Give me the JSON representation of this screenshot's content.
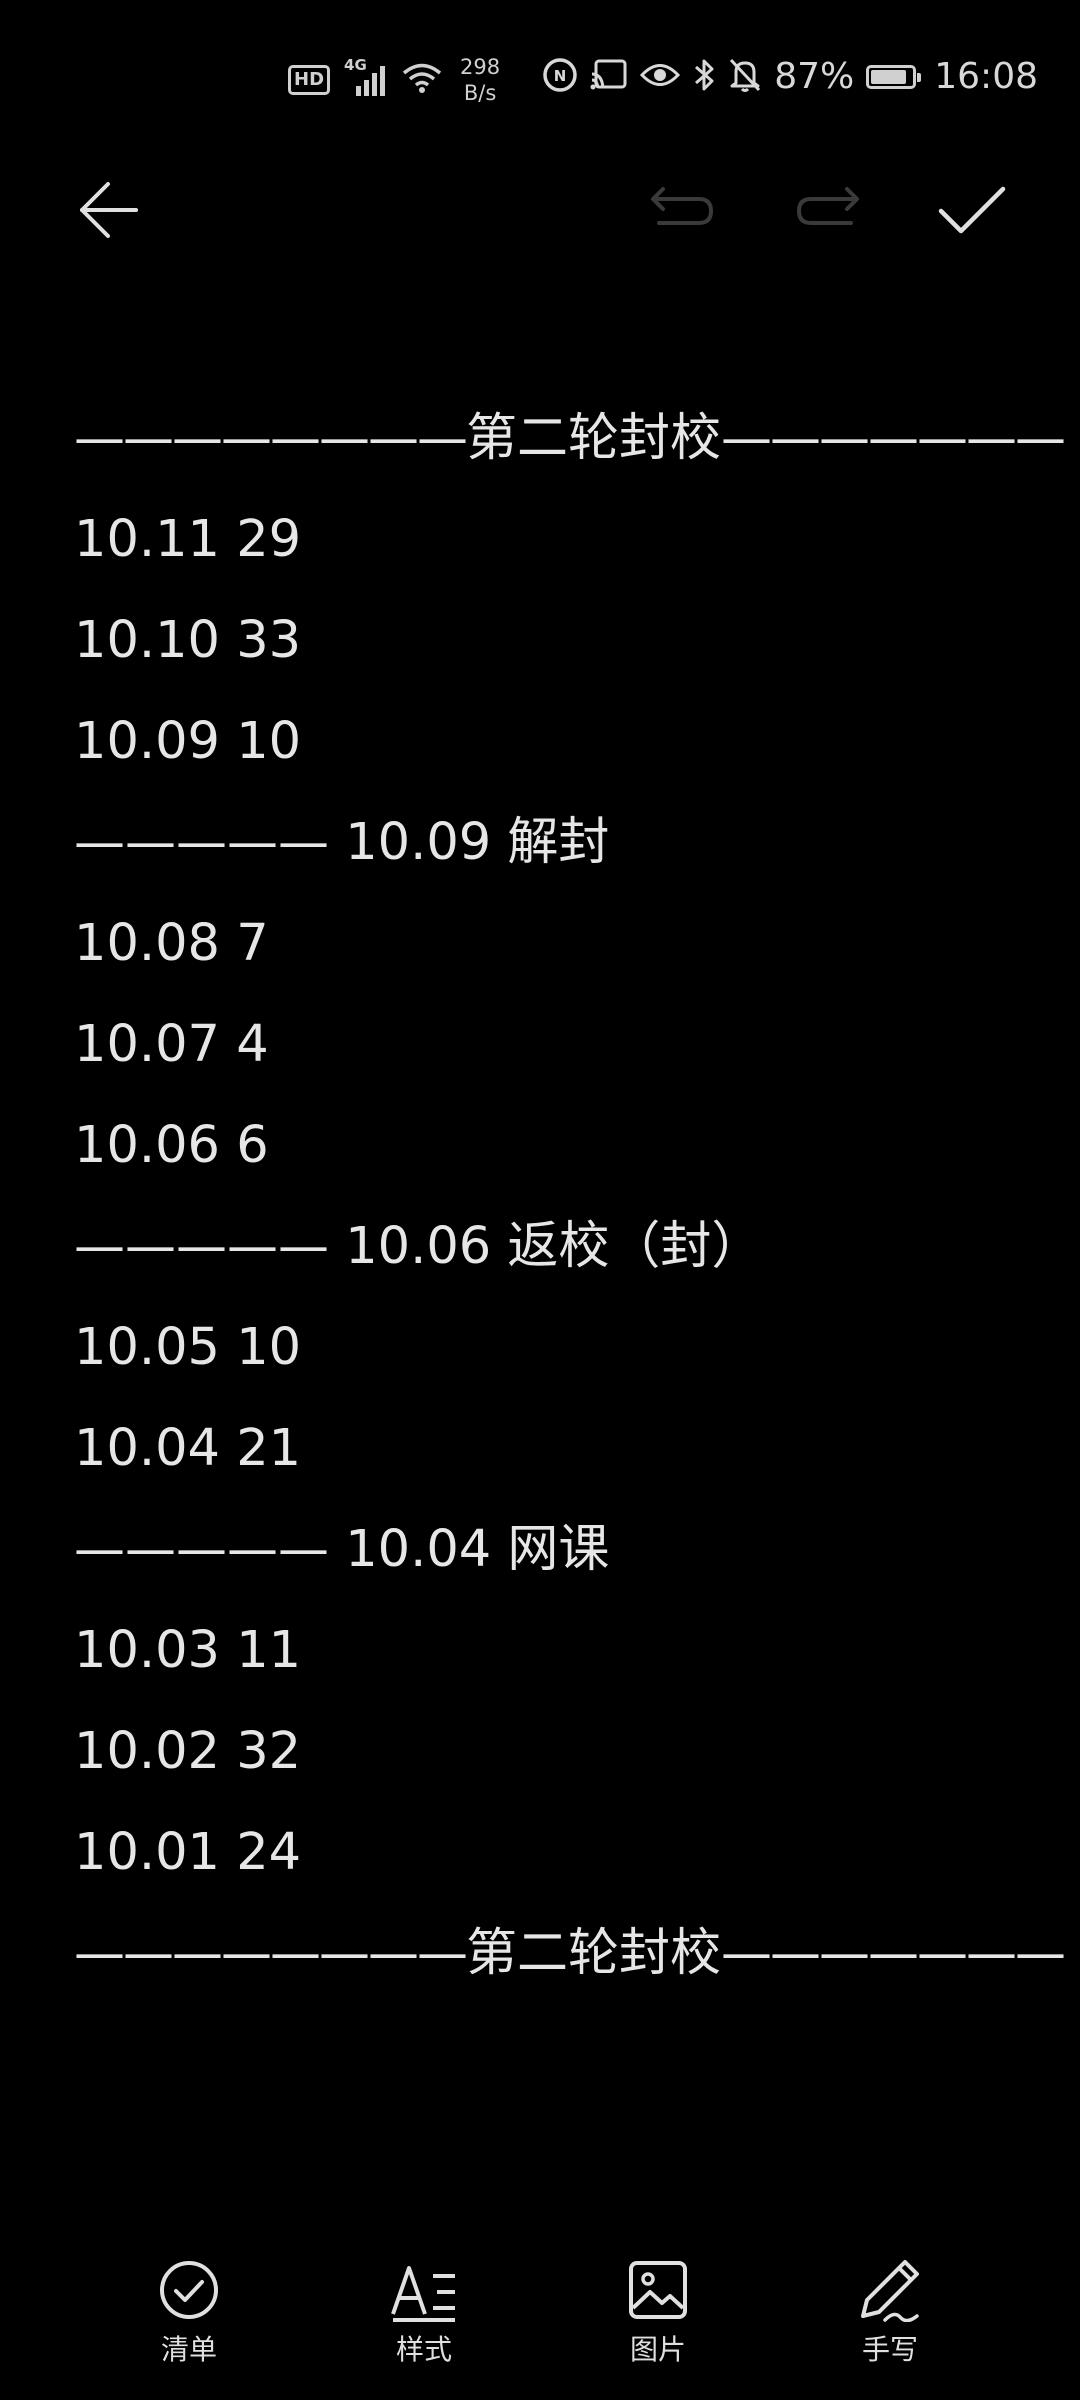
{
  "status_bar": {
    "hd": "HD",
    "network": "4G",
    "net_speed_value": "298",
    "net_speed_unit": "B/s",
    "battery_percent": "87%",
    "battery_level": 0.87,
    "time": "16:08",
    "icons": [
      "hd-icon",
      "signal-4g-icon",
      "wifi-icon",
      "nfc-icon",
      "cast-icon",
      "eye-comfort-icon",
      "bluetooth-icon",
      "mute-icon",
      "battery-icon"
    ]
  },
  "toolbar": {
    "back_icon": "back-arrow-icon",
    "undo_icon": "undo-icon",
    "redo_icon": "redo-icon",
    "done_icon": "checkmark-icon",
    "undo_enabled": false,
    "redo_enabled": false
  },
  "note": {
    "lines": [
      {
        "type": "divider",
        "left": "————————",
        "text": "第二轮封校",
        "right": "———————"
      },
      {
        "type": "text",
        "text": "10.11 29"
      },
      {
        "type": "text",
        "text": "10.10 33"
      },
      {
        "type": "text",
        "text": "10.09 10"
      },
      {
        "type": "text",
        "text": "————— 10.09 解封"
      },
      {
        "type": "text",
        "text": "10.08 7"
      },
      {
        "type": "text",
        "text": "10.07 4"
      },
      {
        "type": "text",
        "text": "10.06 6"
      },
      {
        "type": "text",
        "text": "————— 10.06 返校（封）"
      },
      {
        "type": "text",
        "text": "10.05 10"
      },
      {
        "type": "text",
        "text": "10.04 21"
      },
      {
        "type": "text",
        "text": "————— 10.04 网课"
      },
      {
        "type": "text",
        "text": "10.03 11"
      },
      {
        "type": "text",
        "text": "10.02 32"
      },
      {
        "type": "text",
        "text": "10.01 24"
      },
      {
        "type": "divider",
        "left": "————————",
        "text": "第二轮封校",
        "right": "———————"
      }
    ]
  },
  "bottom_bar": {
    "items": [
      {
        "label": "清单",
        "icon": "checklist-icon"
      },
      {
        "label": "样式",
        "icon": "text-style-icon"
      },
      {
        "label": "图片",
        "icon": "image-icon"
      },
      {
        "label": "手写",
        "icon": "handwriting-pen-icon"
      }
    ]
  }
}
